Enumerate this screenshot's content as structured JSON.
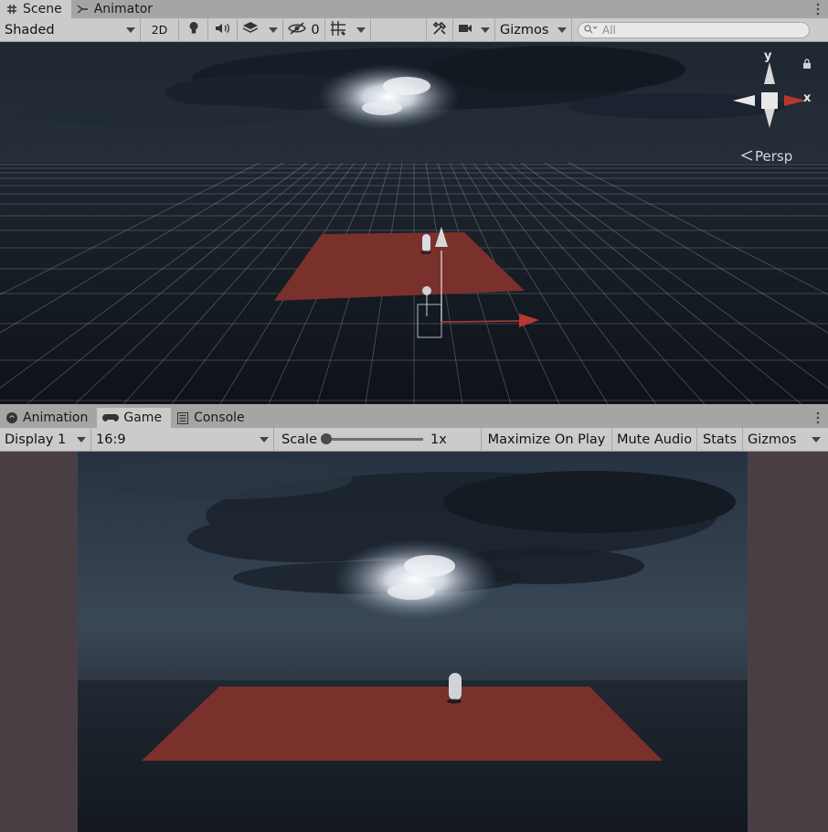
{
  "top_tabs": [
    {
      "label": "Scene",
      "icon": "grid-icon",
      "active": true
    },
    {
      "label": "Animator",
      "icon": "animator-icon",
      "active": false
    }
  ],
  "scene_toolbar": {
    "shading_mode": "Shaded",
    "toggle_2d": "2D",
    "hidden_count": "0",
    "gizmos_label": "Gizmos",
    "search_placeholder": "All"
  },
  "scene_view": {
    "axis_y": "y",
    "axis_x": "x",
    "projection": "Persp"
  },
  "bottom_tabs": [
    {
      "label": "Animation",
      "icon": "animation-icon",
      "active": false
    },
    {
      "label": "Game",
      "icon": "gamepad-icon",
      "active": true
    },
    {
      "label": "Console",
      "icon": "console-icon",
      "active": false
    }
  ],
  "game_toolbar": {
    "display": "Display 1",
    "aspect": "16:9",
    "scale_label": "Scale",
    "scale_value": "1x",
    "scale_fraction": 0.0,
    "maximize_on_play": "Maximize On Play",
    "mute_audio": "Mute Audio",
    "stats": "Stats",
    "gizmos_label": "Gizmos"
  },
  "colors": {
    "panel_bg": "#cbcbcb",
    "tab_strip": "#a5a5a5",
    "ground_plane": "#7a312c",
    "game_letterbox": "#4a3e45",
    "axis_x": "#b5392f",
    "axis_y": "#d8d8d8"
  }
}
